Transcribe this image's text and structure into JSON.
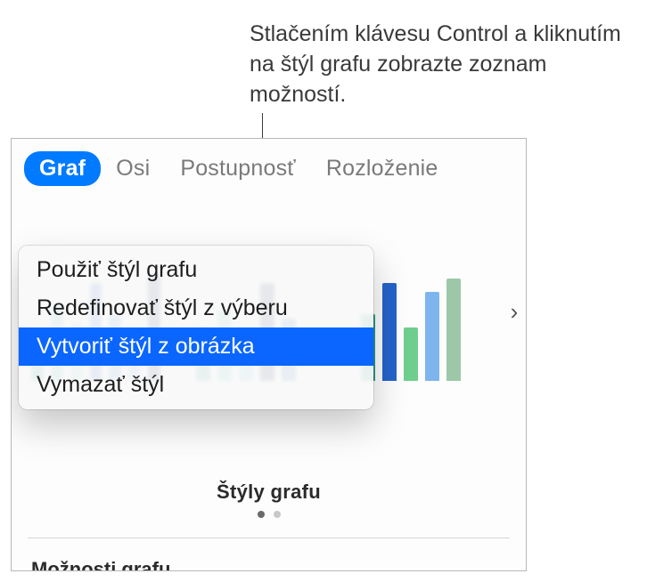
{
  "callout": "Stlačením klávesu Control a kliknutím na štýl grafu zobrazte zoznam možností.",
  "tabs": {
    "graf": "Graf",
    "osi": "Osi",
    "postupnost": "Postupnosť",
    "rozlozenie": "Rozloženie"
  },
  "contextMenu": {
    "apply": "Použiť štýl grafu",
    "redefine": "Redefinovať štýl z výberu",
    "createFromImage": "Vytvoriť štýl z obrázka",
    "delete": "Vymazať štýl"
  },
  "stylesLabel": "Štýly grafu",
  "optionsHeading": "Možnosti grafu",
  "navArrowGlyph": "›",
  "styleThumbs": [
    {
      "bars": [
        55,
        85,
        65,
        110,
        75,
        60,
        120
      ]
    },
    {
      "bars": [
        60,
        80,
        55,
        110,
        70
      ]
    },
    {
      "bars": [
        75,
        110,
        60,
        100,
        115
      ]
    }
  ]
}
